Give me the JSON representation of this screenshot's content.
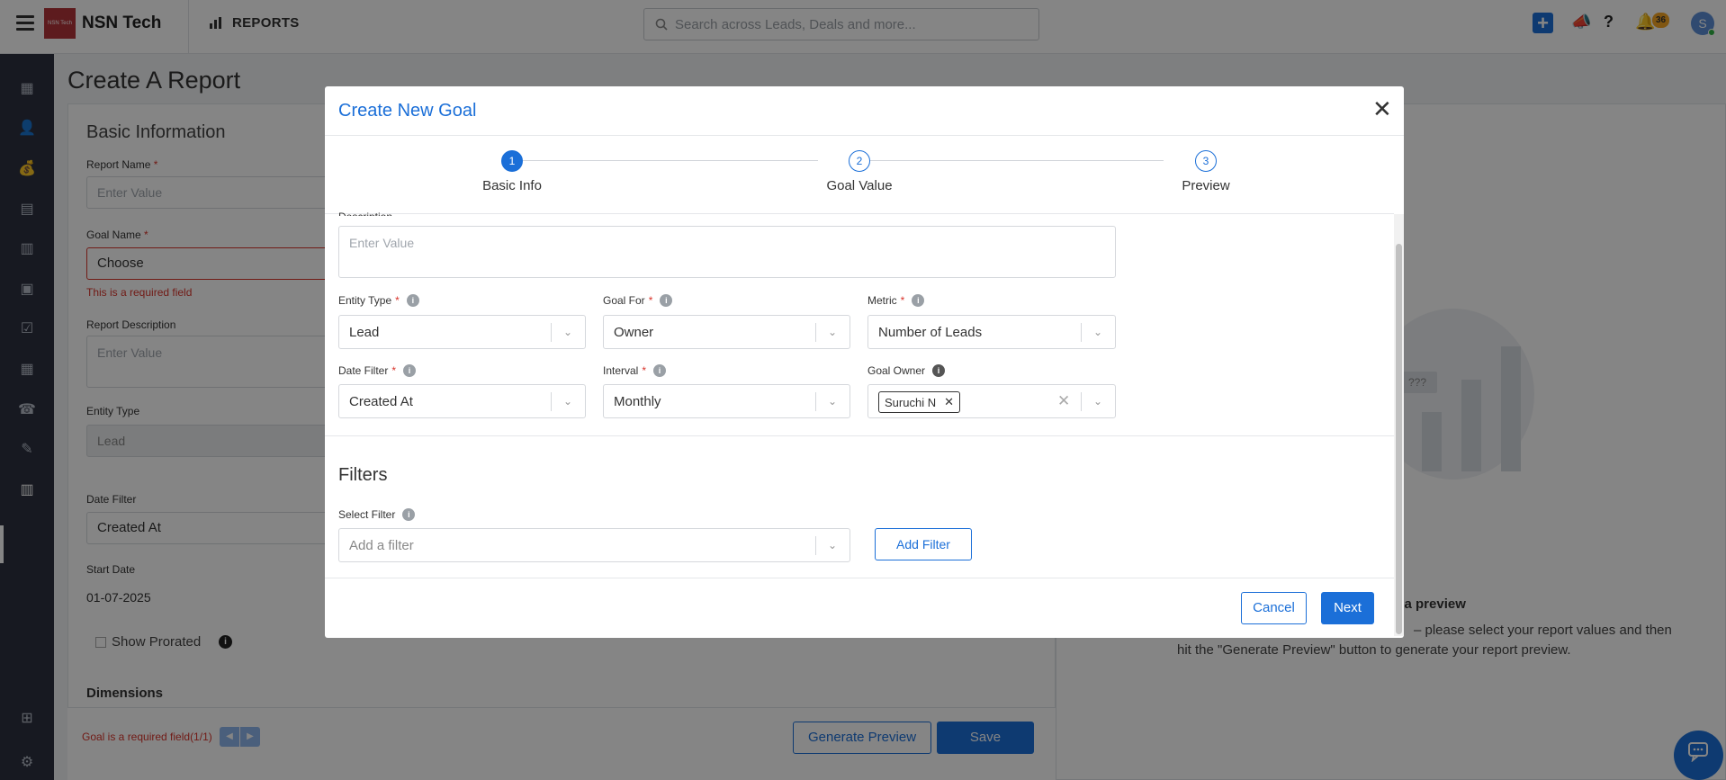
{
  "topbar": {
    "logo_text": "NSN Tech",
    "brand": "NSN Tech",
    "nav_label": "REPORTS",
    "search_placeholder": "Search across Leads, Deals and more...",
    "notification_count": "36",
    "avatar_initial": "S"
  },
  "page": {
    "title": "Create A Report",
    "section_title": "Basic Information",
    "report_name_label": "Report Name",
    "report_name_placeholder": "Enter Value",
    "goal_name_label": "Goal Name",
    "goal_name_value": "Choose",
    "goal_name_error": "This is a required field",
    "report_description_label": "Report Description",
    "report_description_placeholder": "Enter Value",
    "entity_type_label": "Entity Type",
    "entity_type_value": "Lead",
    "date_filter_label": "Date Filter",
    "date_filter_value": "Created At",
    "start_date_label": "Start Date",
    "start_date_value": "01-07-2025",
    "show_prorated_label": "Show Prorated",
    "dimensions_label": "Dimensions",
    "bottom_error": "Goal is a required field(1/1)",
    "generate_preview_label": "Generate Preview",
    "save_label": "Save",
    "preview_title": "e a preview",
    "preview_desc_line1": "– please select your report values and then",
    "preview_desc_line2": "hit the \"Generate Preview\" button to generate your report preview.",
    "illustration_text": "???"
  },
  "modal": {
    "title": "Create New Goal",
    "steps": [
      {
        "number": "1",
        "label": "Basic Info",
        "active": true
      },
      {
        "number": "2",
        "label": "Goal Value",
        "active": false
      },
      {
        "number": "3",
        "label": "Preview",
        "active": false
      }
    ],
    "description_label": "Description",
    "description_placeholder": "Enter Value",
    "entity_type_label": "Entity Type",
    "entity_type_value": "Lead",
    "goal_for_label": "Goal For",
    "goal_for_value": "Owner",
    "metric_label": "Metric",
    "metric_value": "Number of Leads",
    "date_filter_label": "Date Filter",
    "date_filter_value": "Created At",
    "interval_label": "Interval",
    "interval_value": "Monthly",
    "goal_owner_label": "Goal Owner",
    "goal_owner_chip": "Suruchi N",
    "filters_title": "Filters",
    "select_filter_label": "Select Filter",
    "select_filter_placeholder": "Add a filter",
    "add_filter_label": "Add Filter",
    "cancel_label": "Cancel",
    "next_label": "Next"
  },
  "colors": {
    "accent": "#1b6fd8",
    "error": "#d9342b",
    "sidebar": "#2c3140"
  }
}
